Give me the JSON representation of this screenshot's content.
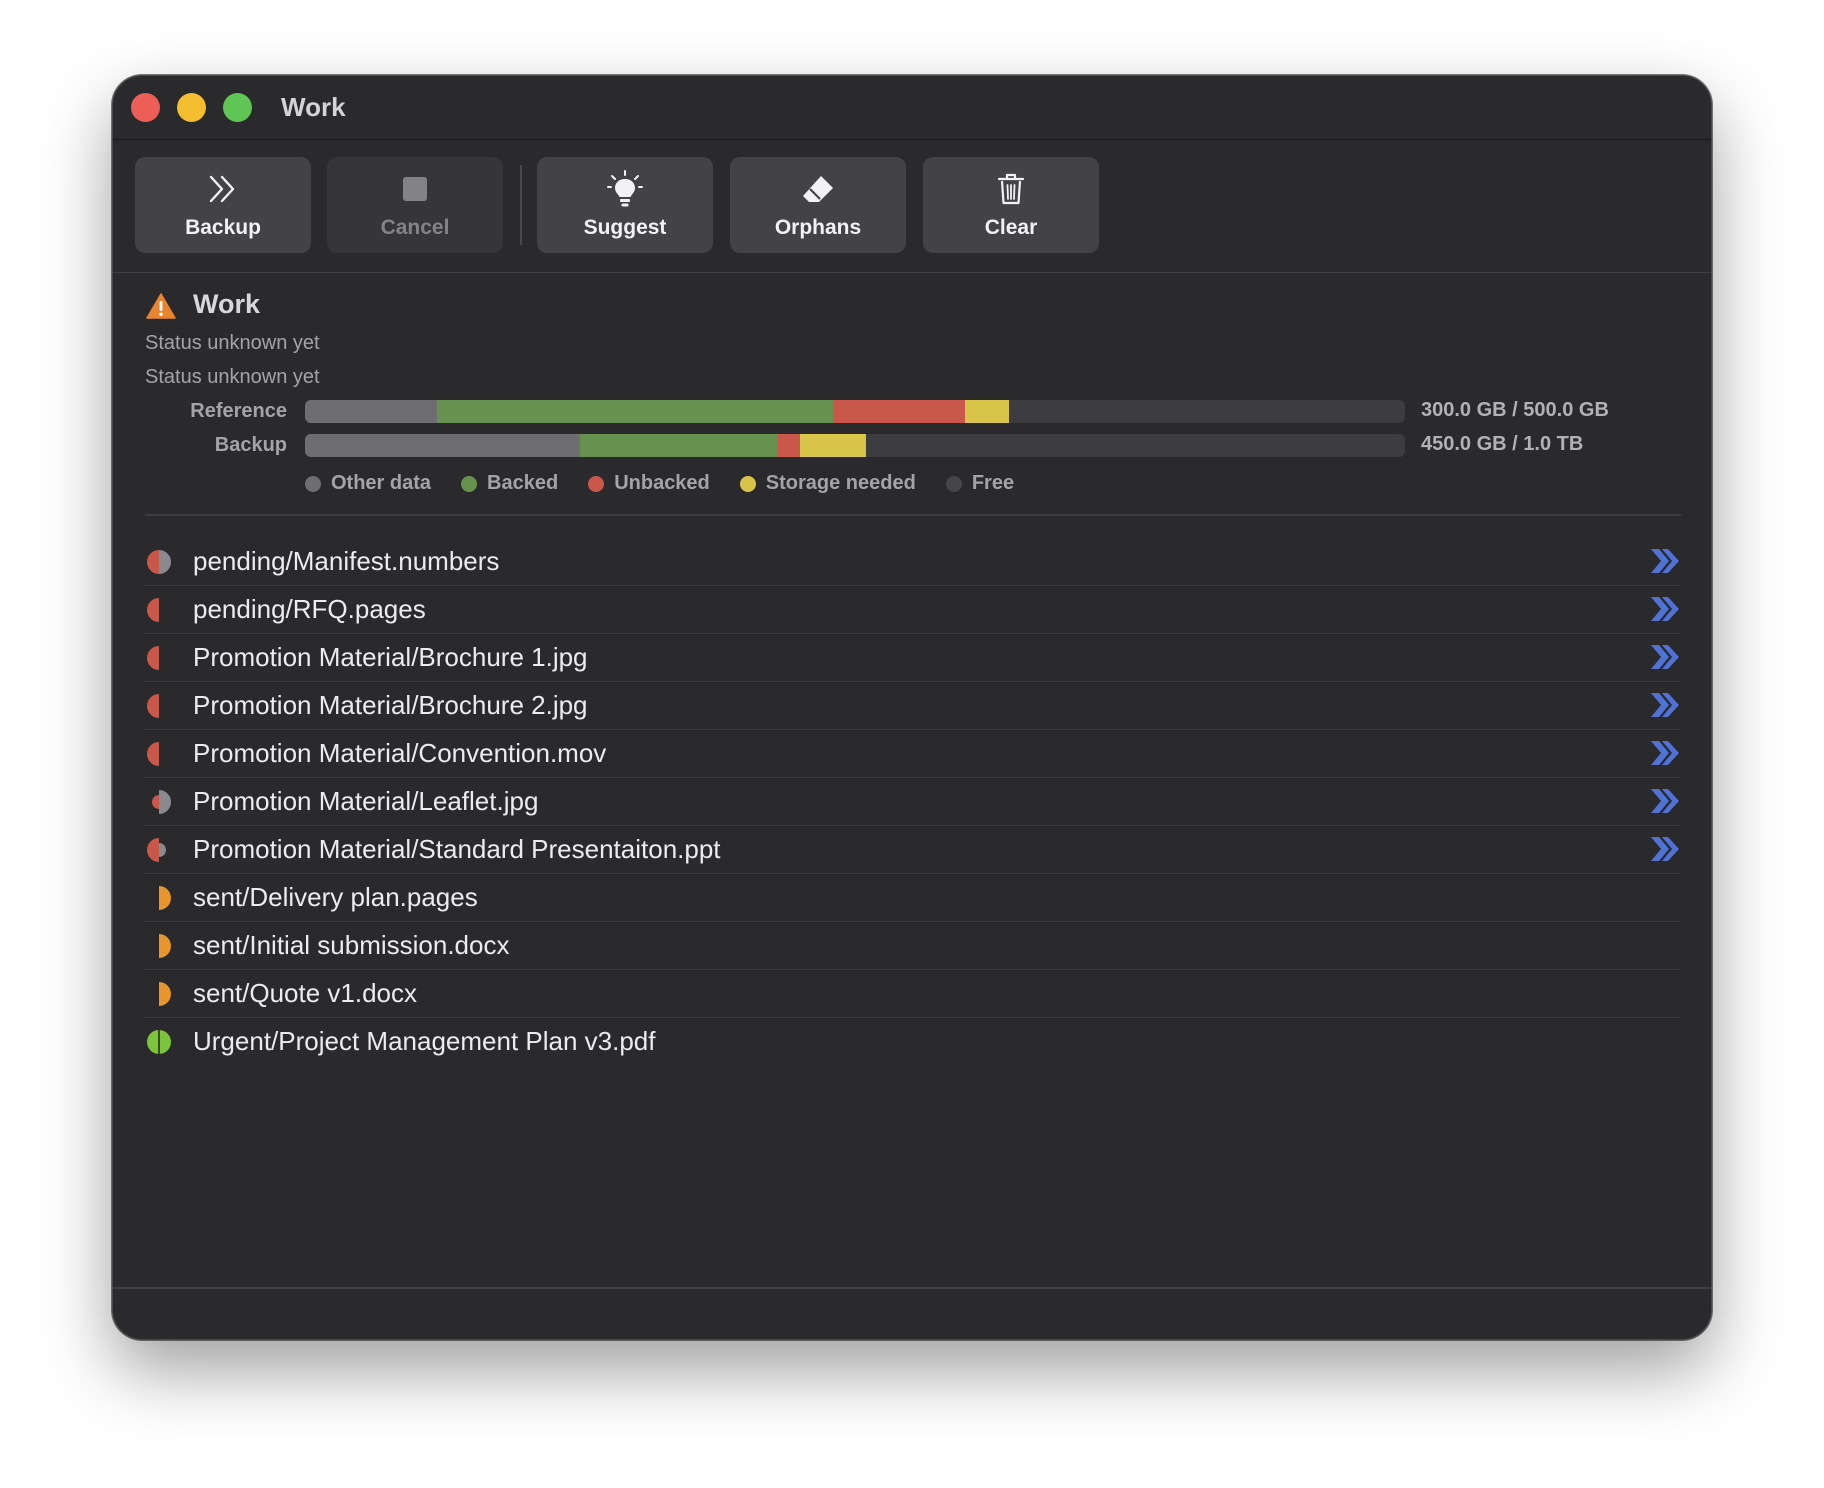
{
  "window": {
    "title": "Work"
  },
  "toolbar": {
    "buttons": [
      {
        "id": "backup",
        "label": "Backup",
        "icon": "double-chevron-right-icon",
        "enabled": true
      },
      {
        "id": "cancel",
        "label": "Cancel",
        "icon": "stop-square-icon",
        "enabled": false
      },
      {
        "id": "suggest",
        "label": "Suggest",
        "icon": "lightbulb-icon",
        "enabled": true
      },
      {
        "id": "orphans",
        "label": "Orphans",
        "icon": "eraser-icon",
        "enabled": true
      },
      {
        "id": "clear",
        "label": "Clear",
        "icon": "trash-icon",
        "enabled": true
      }
    ]
  },
  "volume": {
    "name": "Work",
    "status_icon": "warning-icon",
    "status_lines": [
      "Status unknown yet",
      "Status unknown yet"
    ]
  },
  "usage": {
    "reference": {
      "label": "Reference",
      "size_text": "300.0 GB / 500.0 GB",
      "fractions": {
        "other": 0.12,
        "backed": 0.36,
        "unbacked": 0.12,
        "storage_needed": 0.04
      }
    },
    "backup": {
      "label": "Backup",
      "size_text": "450.0 GB / 1.0 TB",
      "fractions": {
        "other": 0.25,
        "backed": 0.18,
        "unbacked": 0.02,
        "storage_needed": 0.06
      }
    },
    "legend": [
      {
        "label": "Other data",
        "color": "#6e6e72"
      },
      {
        "label": "Backed",
        "color": "#66914f"
      },
      {
        "label": "Unbacked",
        "color": "#c9584a"
      },
      {
        "label": "Storage needed",
        "color": "#d9c44a"
      },
      {
        "label": "Free",
        "color": "#46464a"
      }
    ]
  },
  "colors": {
    "other": "#6e6e72",
    "backed": "#66914f",
    "unbacked": "#c9584a",
    "storage_needed": "#d9c44a",
    "free": "#46464a",
    "chevron": "#4f72d6"
  },
  "files": [
    {
      "name": "pending/Manifest.numbers",
      "status": "red-gray",
      "action": true
    },
    {
      "name": "pending/RFQ.pages",
      "status": "red-left",
      "action": true
    },
    {
      "name": "Promotion Material/Brochure 1.jpg",
      "status": "red-left",
      "action": true
    },
    {
      "name": "Promotion Material/Brochure 2.jpg",
      "status": "red-left",
      "action": true
    },
    {
      "name": "Promotion Material/Convention.mov",
      "status": "red-left",
      "action": true
    },
    {
      "name": "Promotion Material/Leaflet.jpg",
      "status": "small-red-gray",
      "action": true
    },
    {
      "name": "Promotion Material/Standard Presentaiton.ppt",
      "status": "red-small-gray",
      "action": true
    },
    {
      "name": "sent/Delivery plan.pages",
      "status": "orange-right",
      "action": false
    },
    {
      "name": "sent/Initial submission.docx",
      "status": "orange-right",
      "action": false
    },
    {
      "name": "sent/Quote v1.docx",
      "status": "orange-right",
      "action": false
    },
    {
      "name": "Urgent/Project Management Plan v3.pdf",
      "status": "green-full",
      "action": false
    }
  ]
}
